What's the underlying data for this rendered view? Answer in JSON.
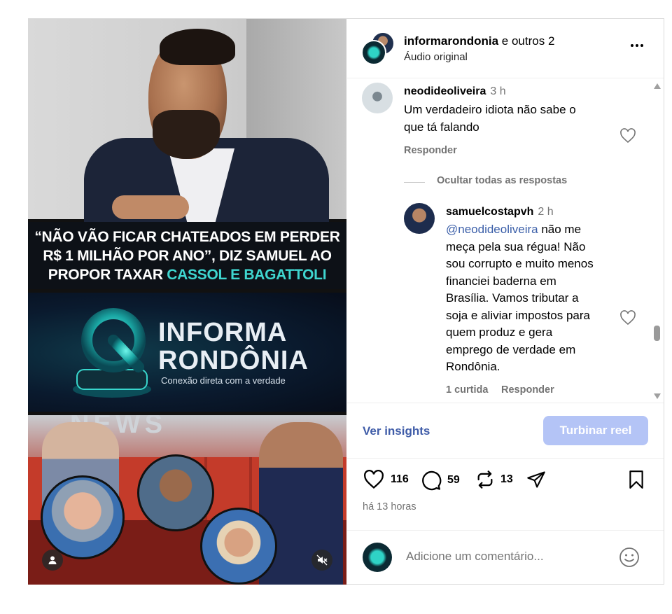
{
  "post": {
    "authors_main": "informarondonia",
    "authors_rest": "e outros 2",
    "audio": "Áudio original",
    "time_ago": "há 13 horas"
  },
  "media": {
    "headline_line1": "“NÃO VÃO FICAR CHATEADOS EM PERDER",
    "headline_line2": "R$ 1 MILHÃO POR ANO”, DIZ SAMUEL AO",
    "headline_line3_pre": "PROPOR TAXAR ",
    "headline_line3_accent": "CASSOL E  BAGATTOLI",
    "brand_line1": "INFORMA",
    "brand_line2": "RONDÔNIA",
    "brand_tagline": "Conexão direta com a verdade",
    "news_word": "NEWS"
  },
  "comments": [
    {
      "user": "neodideoliveira",
      "time": "3 h",
      "text_line1": "Um verdadeiro idiota não sabe o",
      "text_line2": "que tá falando",
      "reply_label": "Responder"
    }
  ],
  "hide_replies": "Ocultar todas as respostas",
  "reply": {
    "user": "samuelcostapvh",
    "time": "2 h",
    "mention": "@neodideoliveira",
    "lines": [
      " não me",
      "meça pela sua régua! Não",
      "sou corrupto e muito menos",
      "financiei baderna em",
      "Brasília. Vamos tributar a",
      "soja e aliviar impostos para",
      "quem produz e gera",
      "emprego de verdade em",
      "Rondônia."
    ],
    "likes": "1 curtida",
    "reply_label": "Responder"
  },
  "bar": {
    "insights": "Ver insights",
    "boost": "Turbinar reel"
  },
  "stats": {
    "likes": "116",
    "comments": "59",
    "reposts": "13"
  },
  "add_comment": {
    "placeholder": "Adicione um comentário..."
  },
  "colors": {
    "accent_link": "#3f5ca8",
    "boost_button": "#b4c4f6",
    "headline_accent": "#3fd6d0",
    "muted_text": "#737373"
  }
}
